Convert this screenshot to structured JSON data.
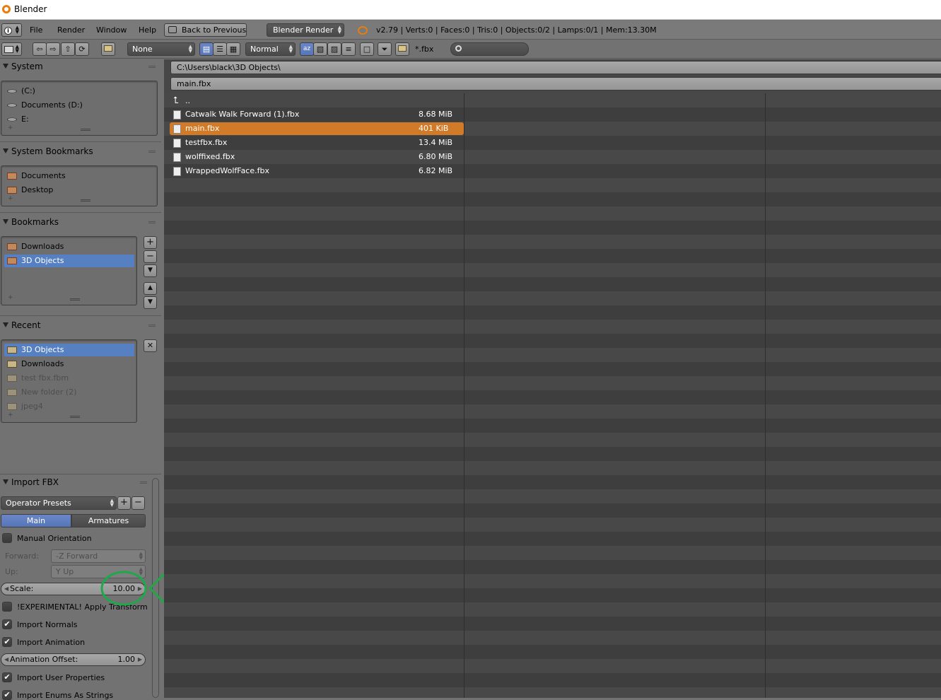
{
  "window": {
    "title": "Blender"
  },
  "menu": {
    "items": [
      "File",
      "Render",
      "Window",
      "Help"
    ],
    "back_button": "Back to Previous",
    "engine": "Blender Render",
    "stats": "v2.79 | Verts:0 | Faces:0 | Tris:0 | Objects:0/2 | Lamps:0/1 | Mem:13.30M"
  },
  "toolbar": {
    "recursion": "None",
    "thumb_size": "Normal",
    "filter_glob": "*.fbx",
    "search_placeholder": ""
  },
  "system": {
    "header": "System",
    "items": [
      "(C:)",
      "Documents (D:)",
      "E:"
    ]
  },
  "system_bookmarks": {
    "header": "System Bookmarks",
    "items": [
      "Documents",
      "Desktop"
    ]
  },
  "bookmarks": {
    "header": "Bookmarks",
    "items": [
      "Downloads",
      "3D Objects"
    ]
  },
  "recent": {
    "header": "Recent",
    "items": [
      "3D Objects",
      "Downloads",
      "test fbx.fbm",
      "New folder (2)",
      "jpeg4"
    ]
  },
  "file_browser": {
    "directory": "C:\\Users\\black\\3D Objects\\",
    "filename": "main.fbx",
    "parent": "..",
    "files": [
      {
        "name": "Catwalk Walk Forward (1).fbx",
        "size": "8.68 MiB"
      },
      {
        "name": "main.fbx",
        "size": "401 KiB"
      },
      {
        "name": "testfbx.fbx",
        "size": "13.4 MiB"
      },
      {
        "name": "wolffixed.fbx",
        "size": "6.80 MiB"
      },
      {
        "name": "WrappedWolfFace.fbx",
        "size": "6.82 MiB"
      }
    ]
  },
  "import_fbx": {
    "header": "Import FBX",
    "presets": "Operator Presets",
    "tab_main": "Main",
    "tab_armatures": "Armatures",
    "manual_orientation": "Manual Orientation",
    "forward_label": "Forward:",
    "forward_value": "-Z Forward",
    "up_label": "Up:",
    "up_value": "Y Up",
    "scale_label": "Scale:",
    "scale_value": "10.00",
    "apply_transform": "!EXPERIMENTAL! Apply Transform",
    "import_normals": "Import Normals",
    "import_animation": "Import Animation",
    "anim_offset_label": "Animation Offset:",
    "anim_offset_value": "1.00",
    "import_user_props": "Import User Properties",
    "import_enums": "Import Enums As Strings"
  },
  "colors": {
    "selected_file": "#d17a28",
    "selected_item": "#5680c2",
    "annotation": "#1ea84a"
  }
}
